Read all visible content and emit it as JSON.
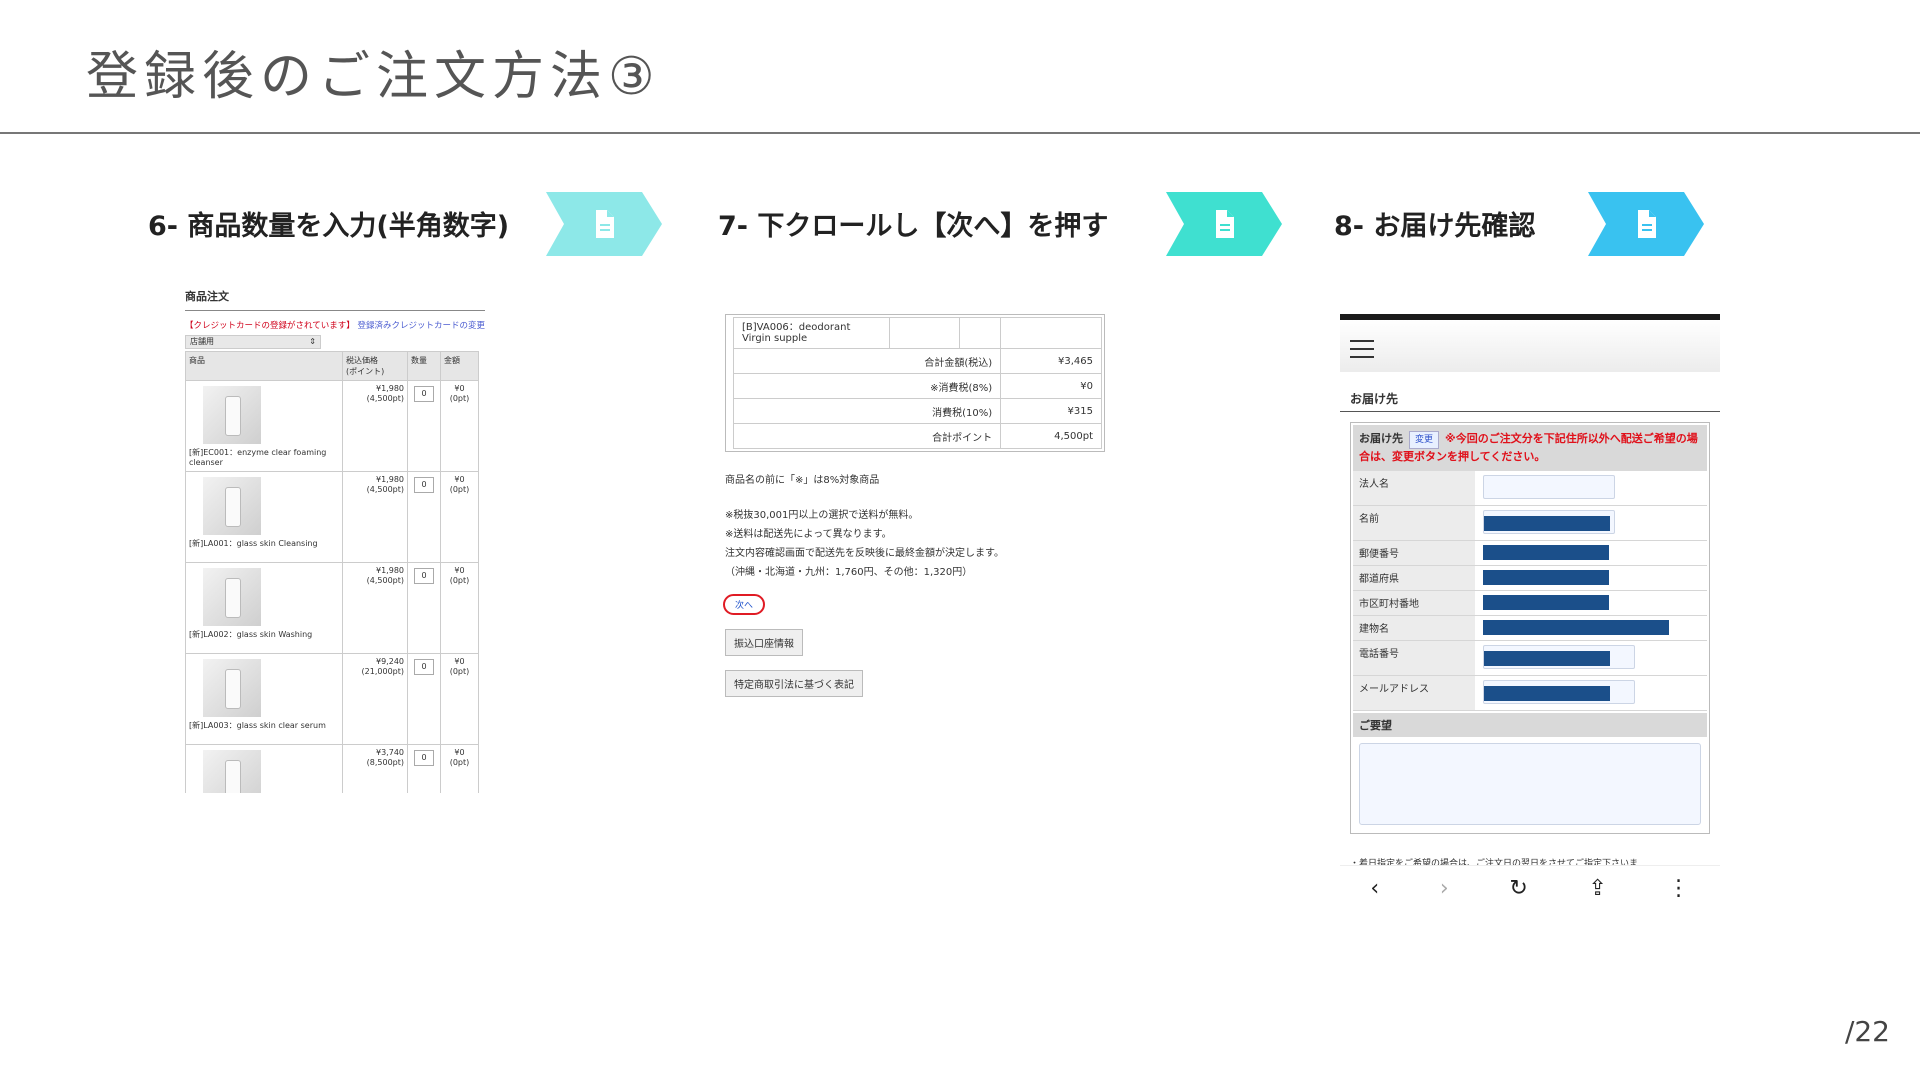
{
  "slide": {
    "title": "登録後のご注文方法③",
    "page_number": "/22",
    "accent_colors": [
      "#8de8e8",
      "#3fe0d0",
      "#39c2f0"
    ]
  },
  "steps": [
    {
      "label": "6- 商品数量を入力(半角数字)",
      "icon": "document-icon",
      "color": "#8de8e8"
    },
    {
      "label": "7- 下クロールし【次へ】を押す",
      "icon": "document-icon",
      "color": "#3fe0d0"
    },
    {
      "label": "8- お届け先確認",
      "icon": "document-icon",
      "color": "#39c2f0"
    }
  ],
  "shot1": {
    "header": "商品注文",
    "notice_red": "【クレジットカードの登録がされています】",
    "notice_link": "登録済みクレジットカードの変更",
    "select_value": "店舗用",
    "columns": [
      "商品",
      "税込価格\n(ポイント)",
      "数量",
      "金額"
    ],
    "rows": [
      {
        "name": "[新]EC001：enzyme clear foaming cleanser",
        "price": "¥1,980",
        "points": "(4,500pt)",
        "qty": "0",
        "amount": "¥0",
        "amount_pt": "(0pt)"
      },
      {
        "name": "[新]LA001：glass skin Cleansing",
        "price": "¥1,980",
        "points": "(4,500pt)",
        "qty": "0",
        "amount": "¥0",
        "amount_pt": "(0pt)"
      },
      {
        "name": "[新]LA002：glass skin Washing",
        "price": "¥1,980",
        "points": "(4,500pt)",
        "qty": "0",
        "amount": "¥0",
        "amount_pt": "(0pt)"
      },
      {
        "name": "[新]LA003：glass skin clear serum",
        "price": "¥9,240",
        "points": "(21,000pt)",
        "qty": "0",
        "amount": "¥0",
        "amount_pt": "(0pt)"
      },
      {
        "name": "",
        "price": "¥3,740",
        "points": "(8,500pt)",
        "qty": "0",
        "amount": "¥0",
        "amount_pt": "(0pt)"
      }
    ]
  },
  "shot2": {
    "first_item": "[B]VA006：deodorant Virgin supple",
    "totals": [
      {
        "label": "合計金額(税込)",
        "value": "¥3,465"
      },
      {
        "label": "※消費税(8%)",
        "value": "¥0"
      },
      {
        "label": "消費税(10%)",
        "value": "¥315"
      },
      {
        "label": "合計ポイント",
        "value": "4,500pt"
      }
    ],
    "note": "商品名の前に「※」は8%対象商品",
    "notes": [
      "※税抜30,001円以上の選択で送料が無料。",
      "※送料は配送先によって異なります。",
      "注文内容確認画面で配送先を反映後に最終金額が決定します。",
      "（沖縄・北海道・九州：1,760円、その他：1,320円）"
    ],
    "next_button": "次へ",
    "bank_button": "振込口座情報",
    "law_button": "特定商取引法に基づく表記"
  },
  "shot3": {
    "section_title": "お届け先",
    "form_head_label": "お届け先",
    "change_button": "変更",
    "form_head_notice": "※今回のご注文分を下記住所以外へ配送ご希望の場合は、変更ボタンを押してください。",
    "fields": [
      {
        "label": "法人名",
        "redacted": false
      },
      {
        "label": "名前",
        "redacted": true
      },
      {
        "label": "郵便番号",
        "redacted": true
      },
      {
        "label": "都道府県",
        "redacted": true
      },
      {
        "label": "市区町村番地",
        "redacted": true
      },
      {
        "label": "建物名",
        "redacted": true
      },
      {
        "label": "電話番号",
        "redacted": true
      },
      {
        "label": "メールアドレス",
        "redacted": true
      }
    ],
    "request_label": "ご要望",
    "footer_note": "・着日指定をご希望の場合は、ご注文日の翌日をさせてご指定下さいま",
    "nav": [
      "back-icon",
      "forward-icon",
      "reload-icon",
      "share-icon",
      "more-icon"
    ]
  }
}
